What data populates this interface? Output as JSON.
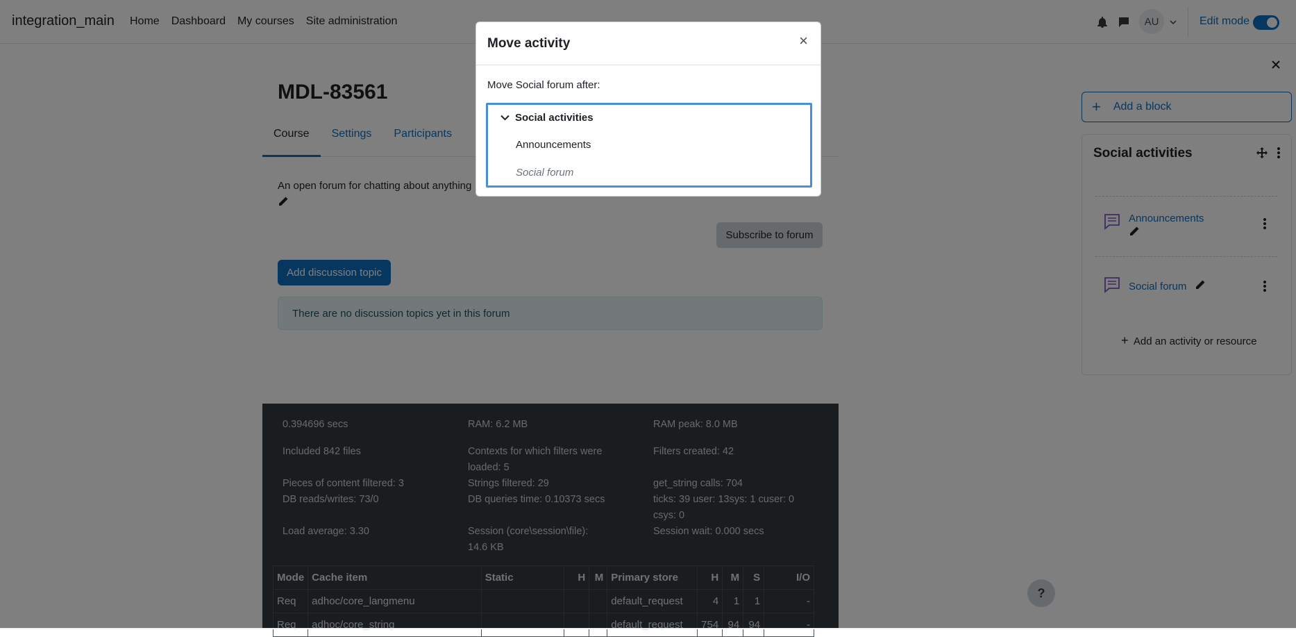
{
  "navbar": {
    "brand": "integration_main",
    "links": [
      "Home",
      "Dashboard",
      "My courses",
      "Site administration"
    ],
    "avatar_initials": "AU",
    "edit_mode_label": "Edit mode",
    "edit_mode_on": true
  },
  "course": {
    "title": "MDL-83561",
    "tabs": [
      "Course",
      "Settings",
      "Participants"
    ],
    "active_tab": "Course",
    "forum_intro": "An open forum for chatting about anything",
    "subscribe_label": "Subscribe to forum",
    "add_topic_label": "Add discussion topic",
    "empty_notice": "There are no discussion topics yet in this forum"
  },
  "perf": {
    "col1": [
      "0.394696 secs",
      "Included 842 files",
      "Pieces of content filtered: 3",
      "DB reads/writes: 73/0",
      "Load average: 3.30"
    ],
    "col2": [
      "RAM: 6.2 MB",
      "Contexts for which filters were loaded: 5",
      "Strings filtered: 29",
      "DB queries time: 0.10373 secs",
      "Session (core\\session\\file): 14.6 KB"
    ],
    "col3": [
      "RAM peak: 8.0 MB",
      "Filters created: 42",
      "get_string calls: 704",
      "ticks: 39 user: 13sys: 1 cuser: 0 csys: 0",
      "Session wait: 0.000 secs"
    ],
    "cache_headers": [
      "Mode",
      "Cache item",
      "Static",
      "H",
      "M",
      "Primary store",
      "H",
      "M",
      "S",
      "I/O"
    ],
    "cache_rows": [
      [
        "Req",
        "adhoc/core_langmenu",
        "",
        "",
        "",
        "default_request",
        "4",
        "1",
        "1",
        "-"
      ],
      [
        "Req",
        "adhoc/core_string",
        "",
        "",
        "",
        "default_request",
        "754",
        "94",
        "94",
        "-"
      ]
    ]
  },
  "drawer": {
    "add_block_label": "Add a block",
    "block_title": "Social activities",
    "activities": [
      "Announcements",
      "Social forum"
    ],
    "add_activity_label": "Add an activity or resource"
  },
  "help_label": "?",
  "modal": {
    "title": "Move activity",
    "close_glyph": "×",
    "prompt": "Move Social forum after:",
    "section": "Social activities",
    "items": [
      "Announcements",
      "Social forum"
    ]
  },
  "colors": {
    "brand_blue": "#0f6cbf",
    "focus_border": "#4a90d9",
    "perf_bg": "#343a40",
    "backdrop": "rgba(0,0,0,0.5)"
  }
}
